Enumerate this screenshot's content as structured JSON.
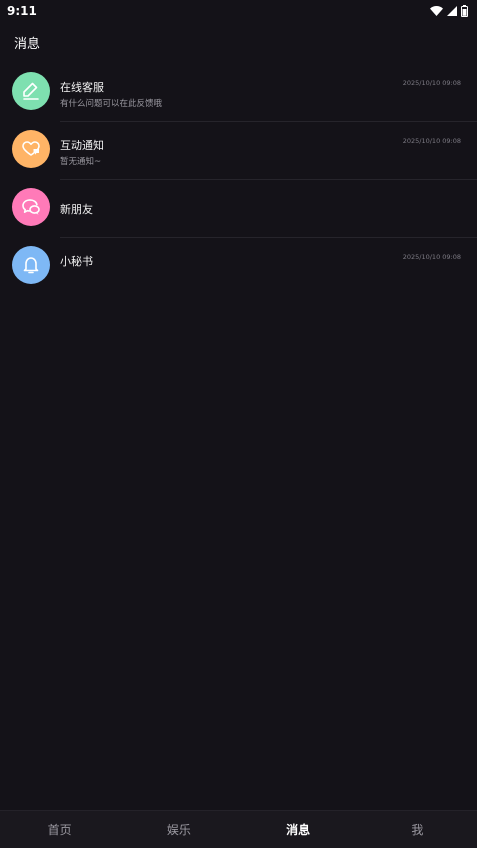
{
  "status_bar": {
    "time": "9:11",
    "icons": [
      "wifi-icon",
      "signal-icon",
      "battery-icon"
    ]
  },
  "page": {
    "title": "消息"
  },
  "messages": [
    {
      "name": "在线客服",
      "preview": "有什么问题可以在此反馈哦",
      "time": "2025/10/10 09:08",
      "icon": "pencil-icon",
      "color": "#7ee0b0"
    },
    {
      "name": "互动通知",
      "preview": "暂无通知~",
      "time": "2025/10/10 09:08",
      "icon": "heart-message-icon",
      "color": "#ffb466"
    },
    {
      "name": "新朋友",
      "preview": "",
      "time": "",
      "icon": "chat-bubbles-icon",
      "color": "#ff7ab8"
    },
    {
      "name": "小秘书",
      "preview": "",
      "time": "2025/10/10 09:08",
      "icon": "bell-icon",
      "color": "#7eb8f5"
    }
  ],
  "bottom_nav": {
    "items": [
      {
        "label": "首页",
        "active": false
      },
      {
        "label": "娱乐",
        "active": false
      },
      {
        "label": "消息",
        "active": true
      },
      {
        "label": "我",
        "active": false
      }
    ]
  }
}
